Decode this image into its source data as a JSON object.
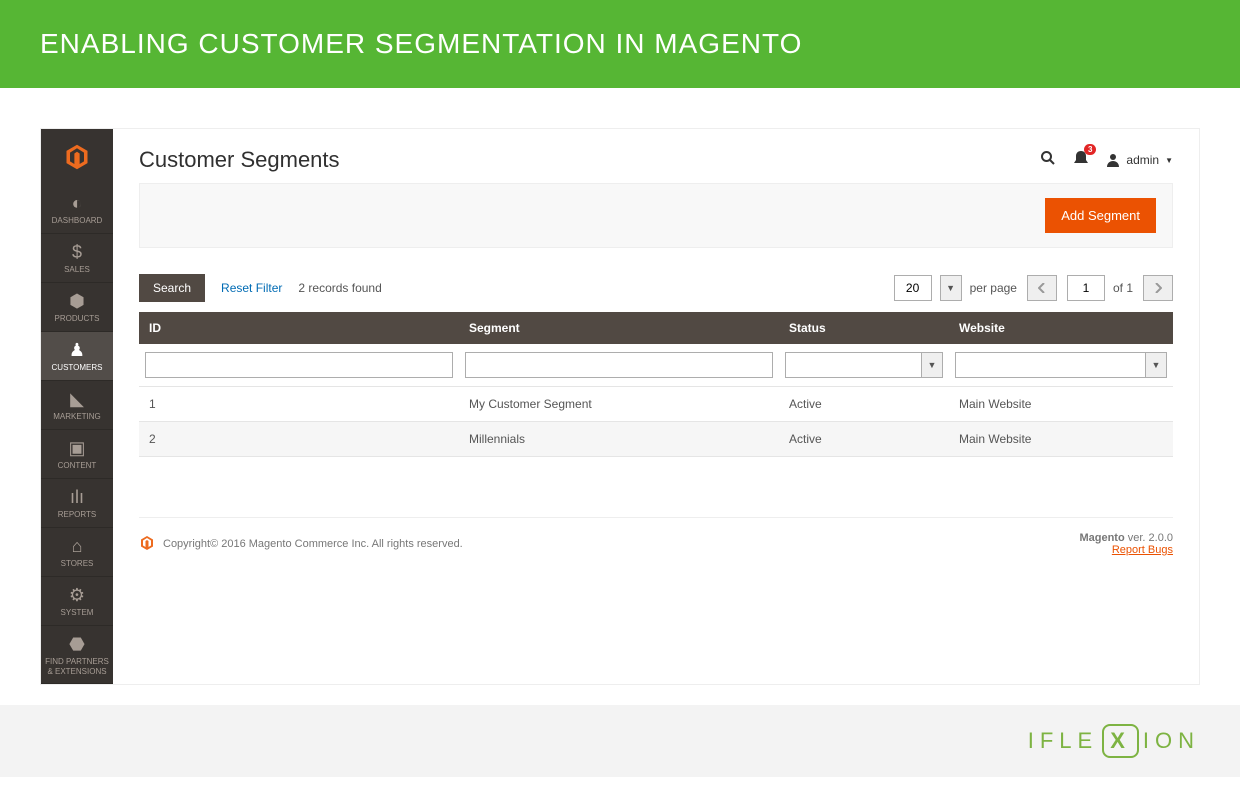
{
  "banner": {
    "title": "ENABLING CUSTOMER SEGMENTATION IN MAGENTO"
  },
  "sidebar": {
    "items": [
      {
        "label": "DASHBOARD"
      },
      {
        "label": "SALES"
      },
      {
        "label": "PRODUCTS"
      },
      {
        "label": "CUSTOMERS"
      },
      {
        "label": "MARKETING"
      },
      {
        "label": "CONTENT"
      },
      {
        "label": "REPORTS"
      },
      {
        "label": "STORES"
      },
      {
        "label": "SYSTEM"
      },
      {
        "label": "FIND PARTNERS & EXTENSIONS"
      }
    ]
  },
  "header": {
    "title": "Customer Segments",
    "notif_count": "3",
    "user": "admin"
  },
  "actions": {
    "add_segment": "Add Segment"
  },
  "grid": {
    "search_label": "Search",
    "reset_label": "Reset Filter",
    "records_found": "2 records found",
    "per_page_value": "20",
    "per_page_label": "per page",
    "page_value": "1",
    "of_label": "of 1",
    "columns": {
      "id": "ID",
      "segment": "Segment",
      "status": "Status",
      "website": "Website"
    },
    "rows": [
      {
        "id": "1",
        "segment": "My Customer Segment",
        "status": "Active",
        "website": "Main Website"
      },
      {
        "id": "2",
        "segment": "Millennials",
        "status": "Active",
        "website": "Main Website"
      }
    ]
  },
  "footer": {
    "copyright": "Copyright© 2016 Magento Commerce Inc. All rights reserved.",
    "version_label": "Magento",
    "version": " ver. 2.0.0",
    "report_bugs": "Report Bugs"
  },
  "branding": {
    "logo_text_left": "IFLE",
    "logo_text_mid": "X",
    "logo_text_right": "ION"
  }
}
